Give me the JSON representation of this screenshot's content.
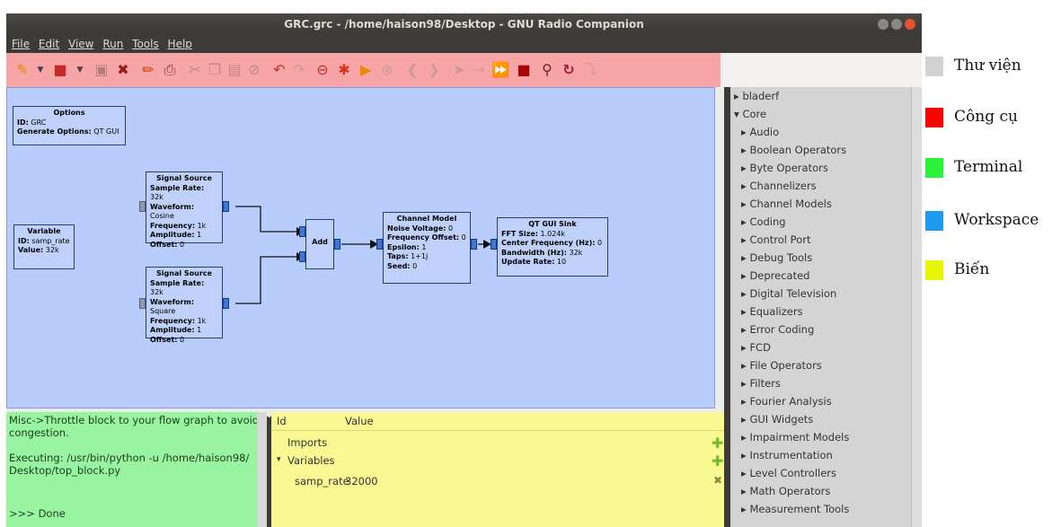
{
  "window": {
    "title": "GRC.grc - /home/haison98/Desktop - GNU Radio Companion"
  },
  "menu": [
    "File",
    "Edit",
    "View",
    "Run",
    "Tools",
    "Help"
  ],
  "blocks": {
    "options": {
      "title": "Options",
      "id_label": "ID:",
      "id_val": "GRC",
      "gen_label": "Generate Options:",
      "gen_val": "QT GUI"
    },
    "variable": {
      "title": "Variable",
      "id_label": "ID:",
      "id_val": "samp_rate",
      "val_label": "Value:",
      "val_val": "32k"
    },
    "sig1": {
      "title": "Signal Source",
      "sr_l": "Sample Rate:",
      "sr": "32k",
      "wf_l": "Waveform:",
      "wf": "Cosine",
      "fr_l": "Frequency:",
      "fr": "1k",
      "am_l": "Amplitude:",
      "am": "1",
      "of_l": "Offset:",
      "of": "0"
    },
    "sig2": {
      "title": "Signal Source",
      "sr_l": "Sample Rate:",
      "sr": "32k",
      "wf_l": "Waveform:",
      "wf": "Square",
      "fr_l": "Frequency:",
      "fr": "1k",
      "am_l": "Amplitude:",
      "am": "1",
      "of_l": "Offset:",
      "of": "0"
    },
    "add": {
      "title": "Add"
    },
    "channel": {
      "title": "Channel Model",
      "nv_l": "Noise Voltage:",
      "nv": "0",
      "fo_l": "Frequency Offset:",
      "fo": "0",
      "ep_l": "Epsilon:",
      "ep": "1",
      "tp_l": "Taps:",
      "tp": "1+1j",
      "sd_l": "Seed:",
      "sd": "0"
    },
    "sink": {
      "title": "QT GUI Sink",
      "fft_l": "FFT Size:",
      "fft": "1.024k",
      "cf_l": "Center Frequency (Hz):",
      "cf": "0",
      "bw_l": "Bandwidth (Hz):",
      "bw": "32k",
      "ur_l": "Update Rate:",
      "ur": "10"
    }
  },
  "library": [
    "bladerf",
    "Core",
    "Audio",
    "Boolean Operators",
    "Byte Operators",
    "Channelizers",
    "Channel Models",
    "Coding",
    "Control Port",
    "Debug Tools",
    "Deprecated",
    "Digital Television",
    "Equalizers",
    "Error Coding",
    "FCD",
    "File Operators",
    "Filters",
    "Fourier Analysis",
    "GUI Widgets",
    "Impairment Models",
    "Instrumentation",
    "Level Controllers",
    "Math Operators",
    "Measurement Tools"
  ],
  "terminal": {
    "l1": "Misc->Throttle block to your flow graph to avoid CPU",
    "l2": "congestion.",
    "l3": "Executing: /usr/bin/python -u /home/haison98/",
    "l4": "Desktop/top_block.py",
    "l5": ">>> Done"
  },
  "variables": {
    "col_id": "Id",
    "col_value": "Value",
    "imports": "Imports",
    "variables": "Variables",
    "var_name": "samp_rate",
    "var_value": "32000"
  },
  "legend": [
    {
      "label": "Thư viện",
      "color": "#d3d3d3"
    },
    {
      "label": "Công cụ",
      "color": "#ff0000"
    },
    {
      "label": "Terminal",
      "color": "#2ef23a"
    },
    {
      "label": "Workspace",
      "color": "#1e9bf0"
    },
    {
      "label": "Biến",
      "color": "#e8f500"
    }
  ],
  "colors": {
    "toolbar": "#f7a5a6",
    "workspace": "#b9cdfc",
    "terminal": "#98f4a1",
    "variables": "#f9f993",
    "library": "#d4d4d4"
  }
}
